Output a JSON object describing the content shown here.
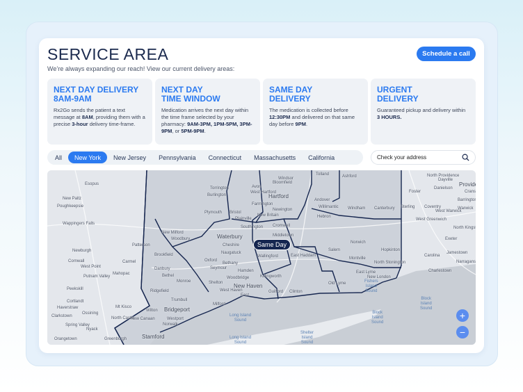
{
  "header": {
    "title": "SERVICE AREA",
    "subtitle": "We’re always expanding our reach! View our current delivery areas:",
    "cta": "Schedule a call"
  },
  "cards": [
    {
      "title": "NEXT DAY DELIVERY\n8AM-9AM",
      "t1": "Rx2Go sends the patient a text message at ",
      "b1": "8AM",
      "t2": ", providing them with a precise ",
      "b2": "3-hour",
      "t3": " delivery time-frame."
    },
    {
      "title": "NEXT DAY\nTIME WINDOW",
      "t1": "Medication arrives the next day within the time frame selected by your pharmacy: ",
      "b1": "9AM-3PM, 1PM-5PM, 3PM-9PM",
      "t2": ", or ",
      "b2": "5PM-9PM",
      "t3": "."
    },
    {
      "title": "SAME DAY\nDELIVERY",
      "t1": "The medication is collected before ",
      "b1": "12:30PM",
      "t2": " and delivered on that same day before ",
      "b2": "9PM",
      "t3": "."
    },
    {
      "title": "URGENT\nDELIVERY",
      "t1": "Guaranteed pickup and delivery within ",
      "b1": "3 HOURS.",
      "t2": "",
      "b2": "",
      "t3": ""
    }
  ],
  "tabs": [
    "All",
    "New York",
    "New Jersey",
    "Pennsylvania",
    "Connecticut",
    "Massachusetts",
    "California"
  ],
  "active_tab": "New York",
  "search": {
    "placeholder": "Check your address",
    "icon": "search-icon"
  },
  "map": {
    "tooltip": "Same Day",
    "places": [
      "Esopus",
      "New Paltz",
      "Poughkeepsie",
      "Wappingers Falls",
      "Newburgh",
      "Cornwall",
      "West Point",
      "Putnam Valley",
      "Peekskill",
      "Cortlandt",
      "Haverstraw",
      "Clarkstown",
      "Ossining",
      "Spring Valley",
      "Nyack",
      "Orangetown",
      "Carmel",
      "Mahopac",
      "Patterson",
      "Mt Kisco",
      "North Castle",
      "New Milford",
      "Woodbury",
      "Brookfield",
      "Danbury",
      "Bethel",
      "Ridgefield",
      "Monroe",
      "Trumbull",
      "Bridgeport",
      "Wilton",
      "New Canaan",
      "Westport",
      "Norwalk",
      "Stamford",
      "Greenburgh",
      "Torrington",
      "Burlington",
      "Plymouth",
      "Bristol",
      "Plainville",
      "Southington",
      "Waterbury",
      "Cheshire",
      "Naugatuck",
      "Oxford",
      "Seymour",
      "Bethany",
      "Hamden",
      "Woodbridge",
      "Shelton",
      "New Haven",
      "West Haven",
      "Milford",
      "East",
      "Avon",
      "West Hartford",
      "Farmington",
      "Hartford",
      "Windsor",
      "Bloomfield",
      "Tolland",
      "Ashford",
      "Dayville",
      "Danielson",
      "Andover",
      "Willimantic",
      "Windham",
      "Canterbury",
      "Sterling",
      "Hebron",
      "Newington",
      "New Britain",
      "Cromwell",
      "Middletown",
      "East Haddam",
      "Wallingford",
      "Salem",
      "Norwich",
      "Montville",
      "Hopkinton",
      "North Stonington",
      "East Lyme",
      "Killingworth",
      "New London",
      "Old Lyme",
      "Guilford",
      "Clinton",
      "North Providence",
      "Providence",
      "Cranston",
      "Foster",
      "Barrington",
      "Coventry",
      "West Warwick",
      "Warwick",
      "West Greenwich",
      "North Kingstown",
      "Exeter",
      "Jamestown",
      "Carolina",
      "Narragansett",
      "Charlestown"
    ],
    "water": [
      "Long Island\nSound",
      "Long Island\nSound",
      "Block\nIsland\nSound",
      "Block\nIsland\nSound",
      "Shelter\nIsland\nSound",
      "Fishers\nIsland\nSound"
    ],
    "zoom_in": "+",
    "zoom_out": "−"
  }
}
